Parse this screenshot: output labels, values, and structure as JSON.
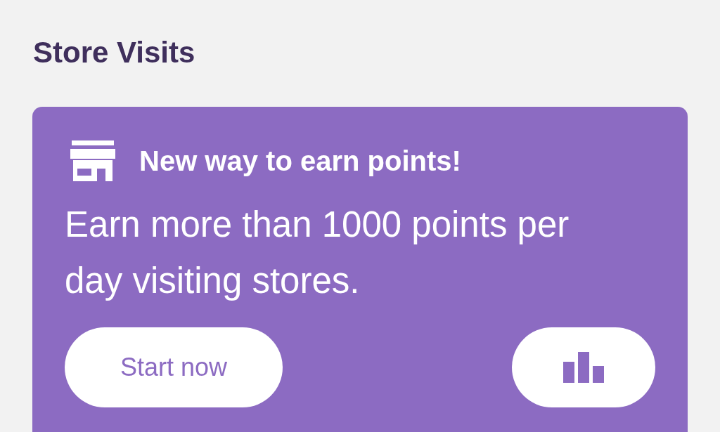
{
  "section": {
    "title": "Store Visits"
  },
  "card": {
    "heading": "New way to earn points!",
    "body": "Earn more than 1000 points per day visiting stores.",
    "primary_button": "Start now"
  }
}
